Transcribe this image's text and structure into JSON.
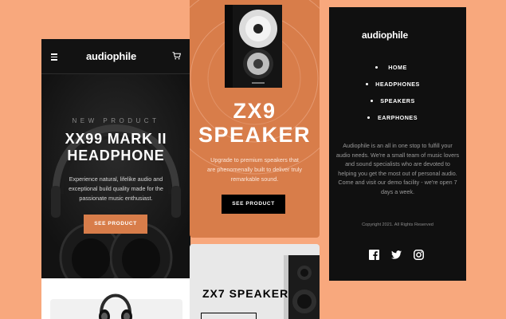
{
  "left_phone": {
    "logo": "audiophile",
    "overline": "NEW PRODUCT",
    "title_line1": "XX99 MARK II",
    "title_line2": "HEADPHONE",
    "description": "Experience natural, lifelike audio and exceptional build quality made for the passionate music enthusiast.",
    "cta": "SEE PRODUCT"
  },
  "middle": {
    "zx9": {
      "title_line1": "ZX9",
      "title_line2": "SPEAKER",
      "description": "Upgrade to premium speakers that are phenomenally built to deliver truly remarkable sound.",
      "cta": "SEE PRODUCT"
    },
    "zx7": {
      "title": "ZX7 SPEAKER"
    }
  },
  "right_phone": {
    "logo": "audiophile",
    "menu": [
      {
        "label": "HOME"
      },
      {
        "label": "HEADPHONES"
      },
      {
        "label": "SPEAKERS"
      },
      {
        "label": "EARPHONES"
      }
    ],
    "about": "Audiophile is an all in one stop to fulfill your audio needs. We're a small team of music lovers and sound specialists who are devoted to helping you get the most out of personal audio. Come and visit our demo facility - we're open 7 days a week.",
    "copyright": "Copyright 2021. All Rights Reserved",
    "social_icons": [
      "facebook-icon",
      "twitter-icon",
      "instagram-icon"
    ]
  },
  "colors": {
    "background": "#F8A87D",
    "accent": "#D87D4A",
    "dark": "#101010",
    "light_gray": "#F1F1F1"
  }
}
